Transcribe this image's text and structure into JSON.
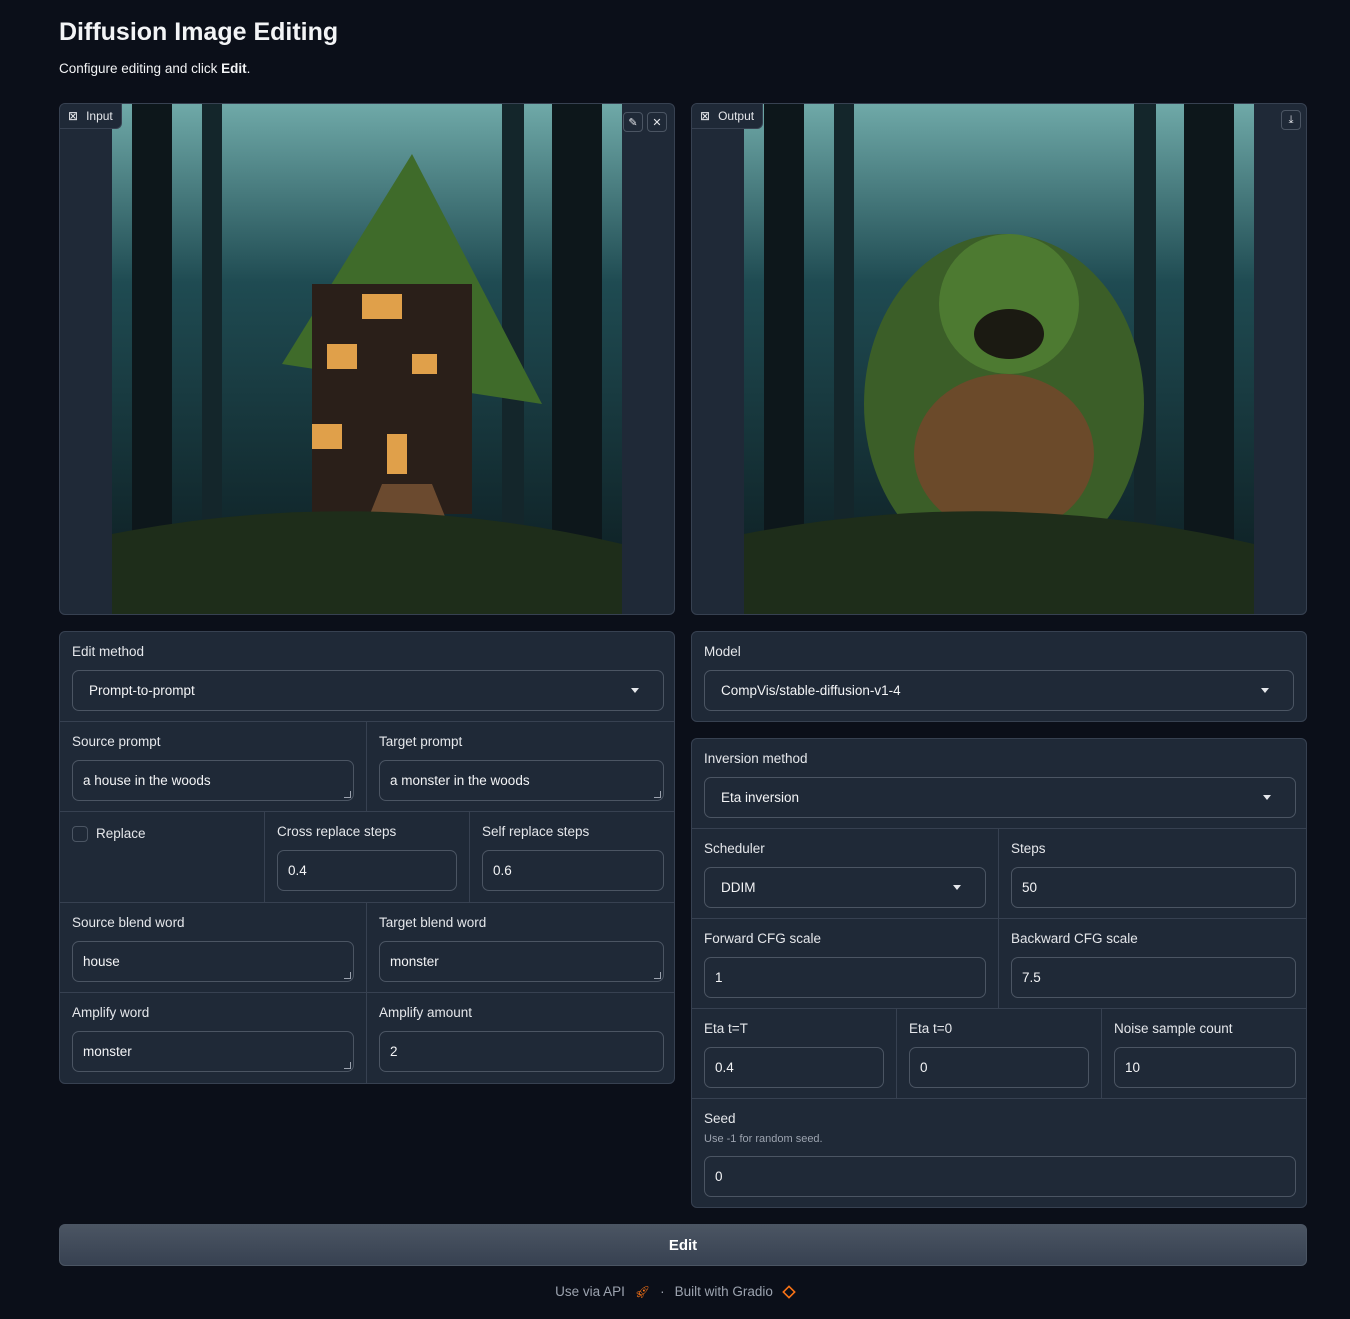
{
  "header": {
    "title": "Diffusion Image Editing",
    "subtitle_prefix": "Configure editing and click ",
    "subtitle_bold": "Edit",
    "subtitle_suffix": "."
  },
  "input_image": {
    "label": "Input",
    "edit_icon": "pencil-icon",
    "clear_icon": "close-icon"
  },
  "output_image": {
    "label": "Output",
    "download_icon": "download-icon"
  },
  "left": {
    "edit_method": {
      "label": "Edit method",
      "value": "Prompt-to-prompt"
    },
    "source_prompt": {
      "label": "Source prompt",
      "value": "a house in the woods"
    },
    "target_prompt": {
      "label": "Target prompt",
      "value": "a monster in the woods"
    },
    "replace": {
      "label": "Replace",
      "checked": false
    },
    "cross_replace_steps": {
      "label": "Cross replace steps",
      "value": "0.4"
    },
    "self_replace_steps": {
      "label": "Self replace steps",
      "value": "0.6"
    },
    "source_blend_word": {
      "label": "Source blend word",
      "value": "house"
    },
    "target_blend_word": {
      "label": "Target blend word",
      "value": "monster"
    },
    "amplify_word": {
      "label": "Amplify word",
      "value": "monster"
    },
    "amplify_amount": {
      "label": "Amplify amount",
      "value": "2"
    }
  },
  "right": {
    "model": {
      "label": "Model",
      "value": "CompVis/stable-diffusion-v1-4"
    },
    "inversion_method": {
      "label": "Inversion method",
      "value": "Eta inversion"
    },
    "scheduler": {
      "label": "Scheduler",
      "value": "DDIM"
    },
    "steps": {
      "label": "Steps",
      "value": "50"
    },
    "forward_cfg": {
      "label": "Forward CFG scale",
      "value": "1"
    },
    "backward_cfg": {
      "label": "Backward CFG scale",
      "value": "7.5"
    },
    "eta_T": {
      "label": "Eta t=T",
      "value": "0.4"
    },
    "eta_0": {
      "label": "Eta t=0",
      "value": "0"
    },
    "noise_count": {
      "label": "Noise sample count",
      "value": "10"
    },
    "seed": {
      "label": "Seed",
      "info": "Use -1 for random seed.",
      "value": "0"
    }
  },
  "edit_button": "Edit",
  "footer": {
    "api": "Use via API",
    "sep": "·",
    "built": "Built with Gradio"
  },
  "colors": {
    "background": "#0b0f19",
    "panel": "#1f2937",
    "border": "#374151",
    "accent": "#f97316"
  }
}
